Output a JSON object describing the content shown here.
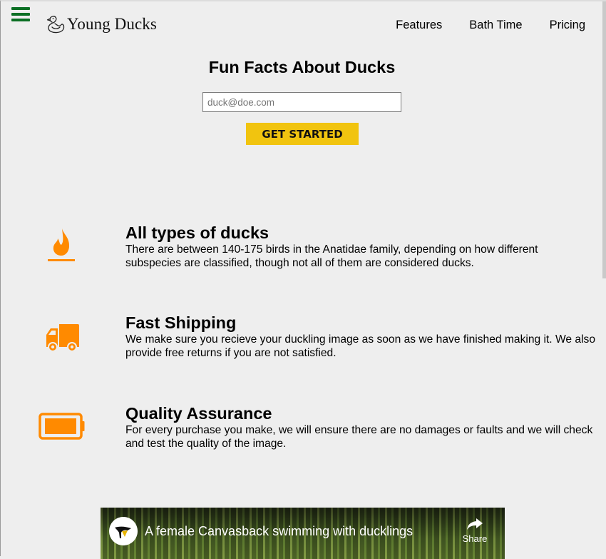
{
  "header": {
    "brand": "Young Ducks",
    "nav": [
      "Features",
      "Bath Time",
      "Pricing"
    ]
  },
  "hero": {
    "title": "Fun Facts About Ducks",
    "email_placeholder": "duck@doe.com",
    "cta_label": "GET STARTED"
  },
  "features": [
    {
      "icon": "fire-icon",
      "title": "All types of ducks",
      "text": "There are between 140-175 birds in the Anatidae family, depending on how different subspecies are classified, though not all of them are considered ducks."
    },
    {
      "icon": "truck-icon",
      "title": "Fast Shipping",
      "text": "We make sure you recieve your duckling image as soon as we have finished making it. We also provide free returns if you are not satisfied."
    },
    {
      "icon": "battery-icon",
      "title": "Quality Assurance",
      "text": "For every purchase you make, we will ensure there are no damages or faults and we will check and test the quality of the image."
    }
  ],
  "video": {
    "title": "A female Canvasback swimming with ducklings",
    "share_label": "Share"
  },
  "colors": {
    "accent_orange": "#ff8a00",
    "cta_yellow": "#f1c40f",
    "menu_green": "#0b6f24",
    "background": "#eeeeee"
  }
}
